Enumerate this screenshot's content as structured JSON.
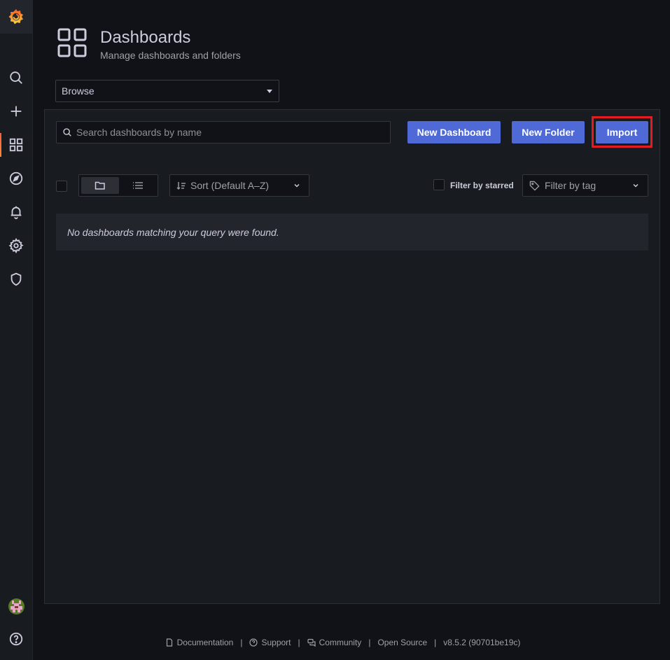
{
  "header": {
    "title": "Dashboards",
    "subtitle": "Manage dashboards and folders"
  },
  "browse_select": {
    "value": "Browse"
  },
  "search": {
    "placeholder": "Search dashboards by name"
  },
  "buttons": {
    "new_dashboard": "New Dashboard",
    "new_folder": "New Folder",
    "import": "Import"
  },
  "sort": {
    "label": "Sort (Default A–Z)"
  },
  "filter_starred": {
    "label": "Filter by starred"
  },
  "filter_tag": {
    "placeholder": "Filter by tag"
  },
  "empty_message": "No dashboards matching your query were found.",
  "footer": {
    "documentation": "Documentation",
    "support": "Support",
    "community": "Community",
    "open_source": "Open Source",
    "version": "v8.5.2 (90701be19c)",
    "separator": "|"
  },
  "colors": {
    "primary_button": "#4f6ad7",
    "highlight_border": "#e31b23",
    "background": "#111217",
    "panel": "#181b1f"
  },
  "sidebar_icons": [
    "grafana-logo-icon",
    "search-icon",
    "plus-icon",
    "dashboards-icon",
    "explore-icon",
    "alerting-icon",
    "gear-icon",
    "shield-icon",
    "user-avatar",
    "help-icon"
  ]
}
